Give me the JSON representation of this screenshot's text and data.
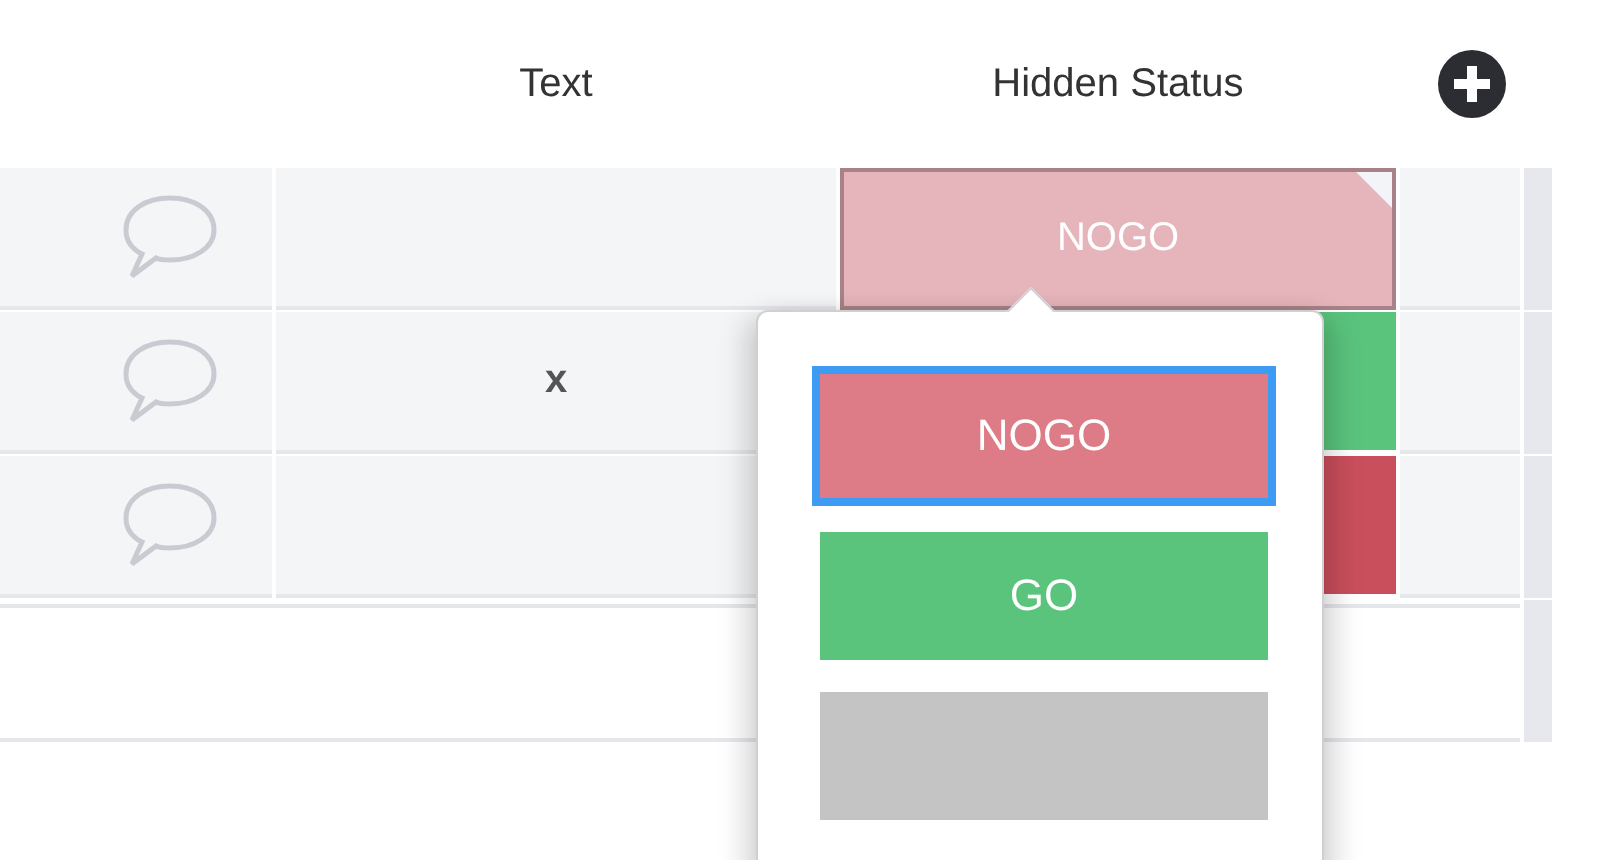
{
  "columns": [
    {
      "label": "Text"
    },
    {
      "label": "Hidden Status"
    }
  ],
  "rows": [
    {
      "text": "",
      "status": {
        "label": "NOGO",
        "color": "#e6b4bb",
        "editing": true
      }
    },
    {
      "text": "x",
      "status": {
        "color": "#5ac47d",
        "editing": false
      }
    },
    {
      "text": "",
      "status": {
        "color": "#c94f5c",
        "editing": false
      }
    }
  ],
  "popup": {
    "options": [
      {
        "label": "NOGO",
        "color": "#dd7c86",
        "selected": true
      },
      {
        "label": "GO",
        "color": "#5ac47d",
        "selected": false
      },
      {
        "color": "#c4c4c4",
        "selected": false
      }
    ]
  }
}
